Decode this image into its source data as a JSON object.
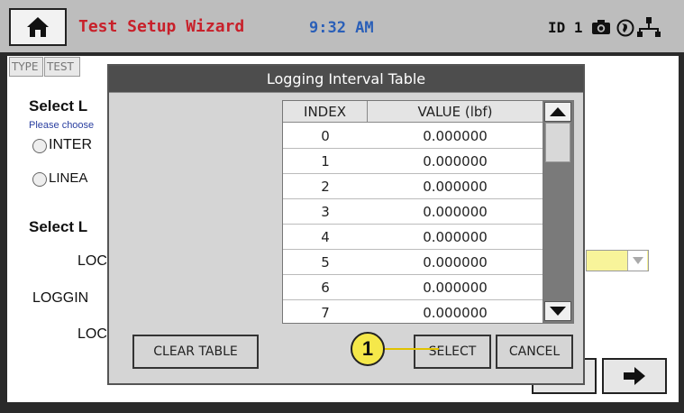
{
  "header": {
    "title": "Test Setup Wizard",
    "time": "9:32 AM",
    "id_label": "ID 1"
  },
  "background": {
    "tabs": [
      "TYPE",
      "TEST"
    ],
    "section1_title": "Select L",
    "section1_hint": "Please choose",
    "radio1_label": "INTER",
    "radio2_label": "LINEA",
    "section2_title": "Select L",
    "field1_label": "LOC",
    "field2_label": "LOGGIN",
    "field3_label": "LOC"
  },
  "dialog": {
    "title": "Logging Interval Table",
    "columns": [
      "INDEX",
      "VALUE (lbf)"
    ],
    "rows": [
      {
        "index": "0",
        "value": "0.000000"
      },
      {
        "index": "1",
        "value": "0.000000"
      },
      {
        "index": "2",
        "value": "0.000000"
      },
      {
        "index": "3",
        "value": "0.000000"
      },
      {
        "index": "4",
        "value": "0.000000"
      },
      {
        "index": "5",
        "value": "0.000000"
      },
      {
        "index": "6",
        "value": "0.000000"
      },
      {
        "index": "7",
        "value": "0.000000"
      }
    ],
    "clear_label": "CLEAR TABLE",
    "select_label": "SELECT",
    "cancel_label": "CANCEL"
  },
  "callout": {
    "label": "1"
  },
  "colors": {
    "title_red": "#c8202a",
    "time_blue": "#2a5fb8",
    "callout_yellow": "#f5e84a"
  }
}
